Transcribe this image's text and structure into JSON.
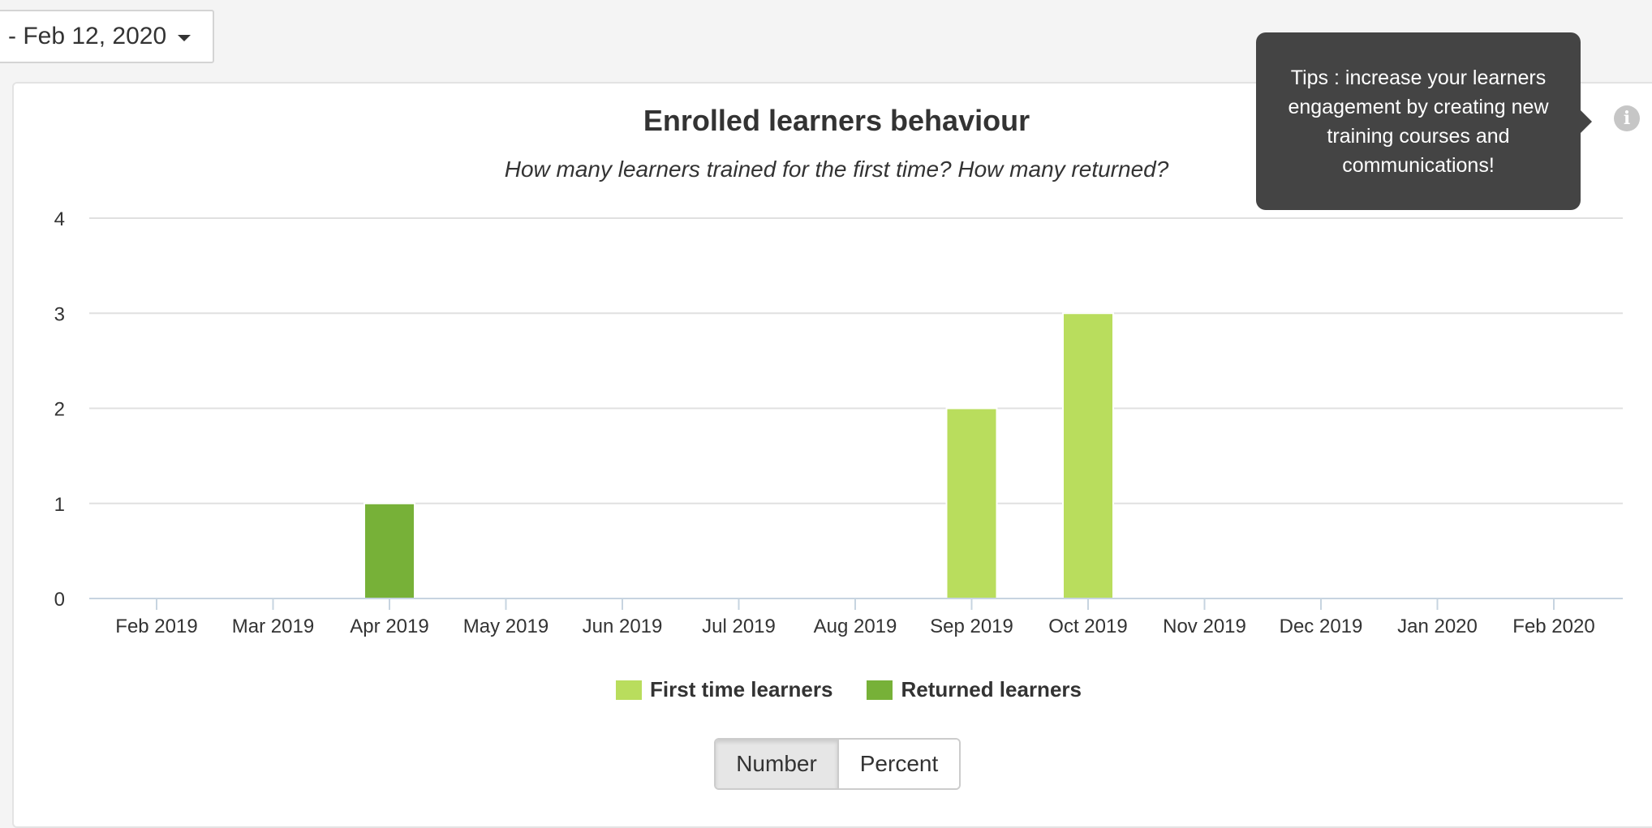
{
  "date_filter": {
    "label": "- Feb 12, 2020",
    "icon": "chevron-down-icon"
  },
  "tooltip": {
    "text": "Tips : increase your learners engagement by creating new training courses and communications!"
  },
  "info_icon": {
    "icon": "info-icon",
    "glyph": "i"
  },
  "toggle": {
    "number_label": "Number",
    "percent_label": "Percent",
    "selected": "Number"
  },
  "colors": {
    "first_time": "#b9dd5d",
    "returned": "#77b138",
    "grid": "#e0e0e0",
    "axis": "#c7d4e0"
  },
  "chart_data": {
    "type": "bar",
    "title": "Enrolled learners behaviour",
    "subtitle": "How many learners trained for the first time? How many returned?",
    "categories": [
      "Feb 2019",
      "Mar 2019",
      "Apr 2019",
      "May 2019",
      "Jun 2019",
      "Jul 2019",
      "Aug 2019",
      "Sep 2019",
      "Oct 2019",
      "Nov 2019",
      "Dec 2019",
      "Jan 2020",
      "Feb 2020"
    ],
    "series": [
      {
        "name": "First time learners",
        "values": [
          0,
          0,
          0,
          0,
          0,
          0,
          0,
          2,
          3,
          0,
          0,
          0,
          0
        ]
      },
      {
        "name": "Returned learners",
        "values": [
          0,
          0,
          1,
          0,
          0,
          0,
          0,
          0,
          0,
          0,
          0,
          0,
          0
        ]
      }
    ],
    "ylim": [
      0,
      4
    ],
    "yticks": [
      0,
      1,
      2,
      3,
      4
    ],
    "grid": true,
    "legend_position": "bottom-center"
  }
}
